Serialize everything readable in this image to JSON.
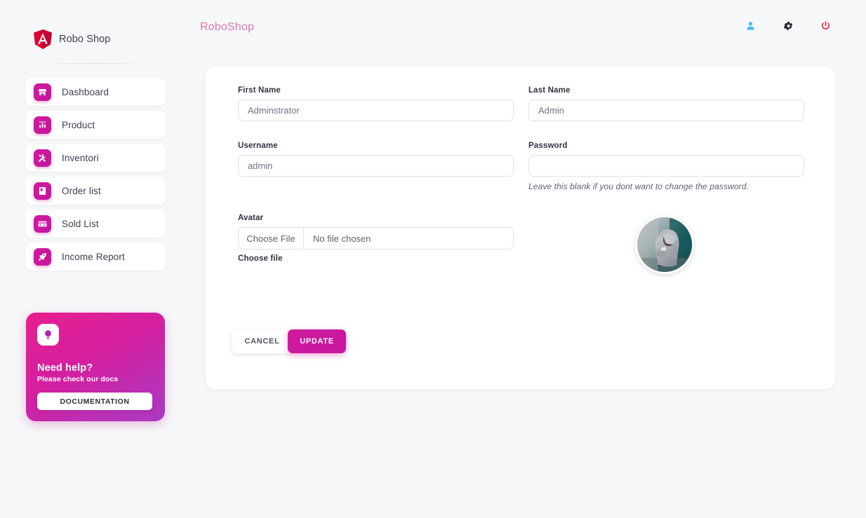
{
  "colors": {
    "page_bg": "#f7f8fa",
    "accent_pink": "#c9199e",
    "help_gradient_start": "#e81f8f",
    "help_gradient_end": "#a93bc4",
    "header_title": "#d978ad",
    "profile_icon": "#4cb8ef",
    "gear_icon": "#23272f",
    "power_icon": "#d81f2a",
    "logo_red": "#dd0031"
  },
  "sidebar": {
    "brand": {
      "label": "Robo Shop",
      "logo_icon": "angular-logo-icon"
    },
    "items": [
      {
        "label": "Dashboard",
        "icon": "store-icon"
      },
      {
        "label": "Product",
        "icon": "bar-chart-icon"
      },
      {
        "label": "Inventori",
        "icon": "tools-icon"
      },
      {
        "label": "Order list",
        "icon": "book-icon"
      },
      {
        "label": "Sold List",
        "icon": "credit-card-icon"
      },
      {
        "label": "Income Report",
        "icon": "rocket-icon"
      }
    ],
    "help_card": {
      "icon": "lightbulb-icon",
      "title": "Need help?",
      "subtitle": "Please check our docs",
      "button_label": "DOCUMENTATION"
    }
  },
  "header": {
    "title": "RoboShop",
    "icons": [
      {
        "name": "profile-icon",
        "label": "Profile"
      },
      {
        "name": "gear-icon",
        "label": "Settings"
      },
      {
        "name": "power-icon",
        "label": "Logout"
      }
    ]
  },
  "form": {
    "first_name": {
      "label": "First Name",
      "value": "Adminstrator",
      "placeholder": "First Name"
    },
    "last_name": {
      "label": "Last Name",
      "value": "Admin",
      "placeholder": "Last Name"
    },
    "username": {
      "label": "Username",
      "value": "admin",
      "placeholder": "Username"
    },
    "password": {
      "label": "Password",
      "value": "",
      "placeholder": "",
      "hint": "Leave this blank if you dont want to change the password."
    },
    "avatar": {
      "label": "Avatar",
      "choose_button": "Choose File",
      "file_status": "No file chosen",
      "helper_label": "Choose file",
      "photo_alt": "user-avatar-photo"
    },
    "actions": {
      "cancel_label": "CANCEL",
      "update_label": "UPDATE"
    }
  }
}
